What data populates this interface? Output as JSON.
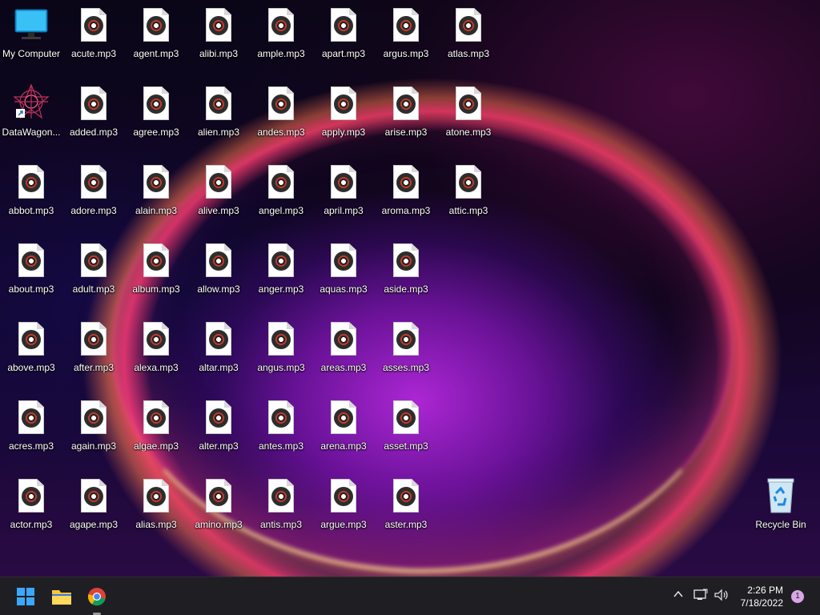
{
  "desktop": {
    "my_computer": "My Computer",
    "datawagon": "DataWagon...",
    "recycle_bin": "Recycle Bin",
    "files": [
      [
        "acute.mp3",
        "added.mp3",
        "adore.mp3",
        "adult.mp3",
        "after.mp3",
        "again.mp3",
        "agape.mp3"
      ],
      [
        "agent.mp3",
        "agree.mp3",
        "alain.mp3",
        "album.mp3",
        "alexa.mp3",
        "algae.mp3",
        "alias.mp3"
      ],
      [
        "alibi.mp3",
        "alien.mp3",
        "alive.mp3",
        "allow.mp3",
        "altar.mp3",
        "alter.mp3",
        "amino.mp3"
      ],
      [
        "ample.mp3",
        "andes.mp3",
        "angel.mp3",
        "anger.mp3",
        "angus.mp3",
        "antes.mp3",
        "antis.mp3"
      ],
      [
        "apart.mp3",
        "apply.mp3",
        "april.mp3",
        "aquas.mp3",
        "areas.mp3",
        "arena.mp3",
        "argue.mp3"
      ],
      [
        "argus.mp3",
        "arise.mp3",
        "aroma.mp3",
        "aside.mp3",
        "asses.mp3",
        "asset.mp3",
        "aster.mp3"
      ],
      [
        "atlas.mp3",
        "atone.mp3",
        "attic.mp3"
      ]
    ],
    "first_col_files": [
      "abbot.mp3",
      "about.mp3",
      "above.mp3",
      "acres.mp3",
      "actor.mp3"
    ]
  },
  "taskbar": {
    "time": "2:26 PM",
    "date": "7/18/2022",
    "notification_count": "1"
  }
}
